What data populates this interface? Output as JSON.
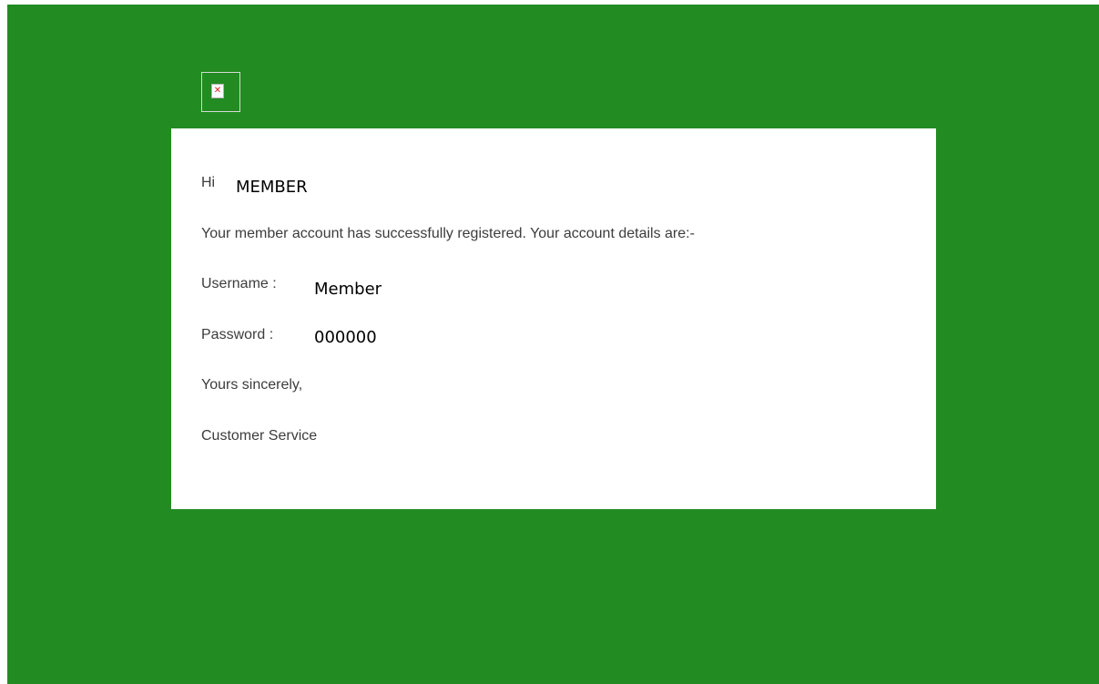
{
  "email": {
    "image_placeholder_icon": "broken-image-icon",
    "greeting": {
      "label": "Hi",
      "name": "MEMBER"
    },
    "intro": "Your member account has successfully registered. Your account details are:-",
    "username": {
      "label": "Username :",
      "value": "Member"
    },
    "password": {
      "label": "Password : ",
      "value": "000000"
    },
    "closing": "Yours sincerely,",
    "signature": "Customer Service"
  },
  "colors": {
    "background_green": "#228b22",
    "card_white": "#ffffff",
    "body_text": "#3c3c3c"
  }
}
